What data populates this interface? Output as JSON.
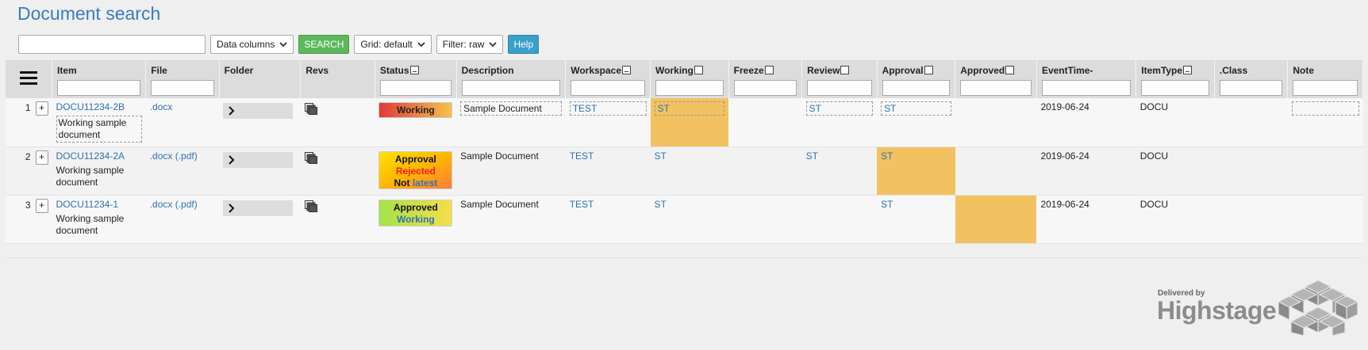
{
  "page": {
    "title": "Document search"
  },
  "toolbar": {
    "search_value": "",
    "data_columns": "Data columns",
    "search": "SEARCH",
    "grid": "Grid: default",
    "filter": "Filter: raw",
    "help": "Help"
  },
  "columns": {
    "item": "Item",
    "file": "File",
    "folder": "Folder",
    "revs": "Revs",
    "status": "Status",
    "description": "Description",
    "workspace": "Workspace",
    "working": "Working",
    "freeze": "Freeze",
    "review": "Review",
    "approval": "Approval",
    "approved": "Approved",
    "eventtime": "EventTime-",
    "itemtype": "ItemType",
    "class": ".Class",
    "note": "Note"
  },
  "rows": [
    {
      "num": "1",
      "item_id": "DOCU11234-2B",
      "item_desc": "Working sample document",
      "file": ".docx",
      "file_pdf": "",
      "status": [
        "Working"
      ],
      "description": "Sample Document",
      "workspace": "TEST",
      "working": "ST",
      "freeze": "",
      "review": "ST",
      "approval": "ST",
      "approved": "",
      "eventtime": "2019-06-24",
      "itemtype": "DOCU",
      "class": "",
      "note": ""
    },
    {
      "num": "2",
      "item_id": "DOCU11234-2A",
      "item_desc": "Working sample document",
      "file": ".docx",
      "file_pdf": "(.pdf)",
      "status": [
        "Approval",
        "Rejected",
        "Not",
        "latest"
      ],
      "description": "Sample Document",
      "workspace": "TEST",
      "working": "ST",
      "freeze": "",
      "review": "ST",
      "approval": "ST",
      "approved": "",
      "eventtime": "2019-06-24",
      "itemtype": "DOCU",
      "class": "",
      "note": ""
    },
    {
      "num": "3",
      "item_id": "DOCU11234-1",
      "item_desc": "Working sample document",
      "file": ".docx",
      "file_pdf": "(.pdf)",
      "status": [
        "Approved",
        "Working"
      ],
      "description": "Sample Document",
      "workspace": "TEST",
      "working": "ST",
      "freeze": "",
      "review": "",
      "approval": "ST",
      "approved": "",
      "eventtime": "2019-06-24",
      "itemtype": "DOCU",
      "class": "",
      "note": ""
    }
  ],
  "brand": {
    "delivered_by": "Delivered by",
    "name": "Highstage"
  },
  "colors": {
    "title_blue": "#3a7cc0",
    "link_blue": "#2f72b3",
    "search_green": "#5cb85c",
    "help_blue": "#3a9fc9",
    "highlight": "#f2c260",
    "header_gray": "#dcdcdc"
  },
  "icons": {
    "menu": "hamburger-menu-icon",
    "chevron": "chevron-down-icon",
    "folder_expand": "chevron-right-icon",
    "revisions": "stacked-documents-icon"
  }
}
